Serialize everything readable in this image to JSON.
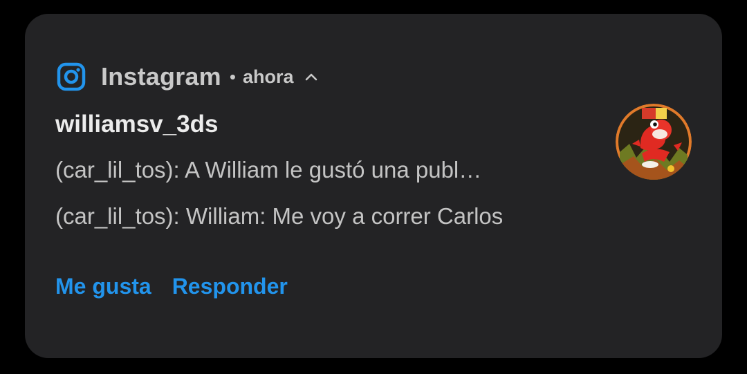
{
  "notification": {
    "app_name": "Instagram",
    "separator": "•",
    "time": "ahora",
    "sender": "williamsv_3ds",
    "messages": [
      "(car_lil_tos): A William le gustó una publ…",
      "(car_lil_tos): William: Me voy a correr Carlos"
    ],
    "actions": {
      "like": "Me gusta",
      "reply": "Responder"
    },
    "icons": {
      "app": "instagram-icon",
      "collapse": "chevron-up-icon",
      "avatar": "avatar"
    },
    "colors": {
      "background": "#000000",
      "card": "#232325",
      "accent": "#2294ec",
      "title_text": "#ececec",
      "body_text": "#c4c4c4"
    }
  }
}
